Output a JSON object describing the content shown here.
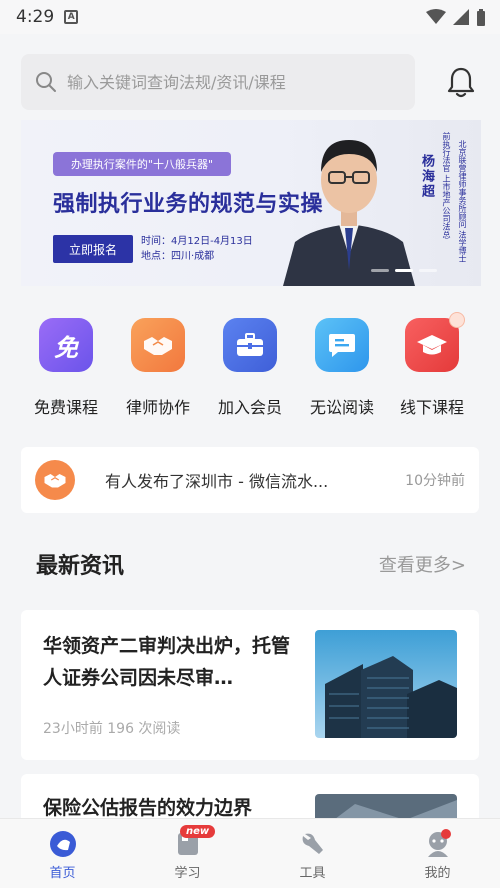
{
  "status": {
    "time": "4:29",
    "app_badge": "A"
  },
  "search": {
    "placeholder": "输入关键词查询法规/资讯/课程"
  },
  "banner": {
    "tag": "办理执行案件的\"十八般兵器\"",
    "title": "强制执行业务的规范与实操",
    "button": "立即报名",
    "time_line": "时间：4月12日-4月13日",
    "place_line": "地点：四川·成都",
    "speaker_name": "杨海超",
    "speaker_title_1": "前执行法官 上市地产公司法总",
    "speaker_title_2": "北京联营律师事务所顾问 法学博士"
  },
  "quick_links": [
    {
      "label": "免费课程",
      "icon": "free-icon",
      "color": "#7b5cf2"
    },
    {
      "label": "律师协作",
      "icon": "handshake-icon",
      "color": "#f38a48"
    },
    {
      "label": "加入会员",
      "icon": "briefcase-icon",
      "color": "#4c6fe6"
    },
    {
      "label": "无讼阅读",
      "icon": "reading-icon",
      "color": "#3ca7f0"
    },
    {
      "label": "线下课程",
      "icon": "graduation-cap-icon",
      "color": "#ef4545"
    }
  ],
  "notice": {
    "text": "有人发布了深圳市 - 微信流水...",
    "time": "10分钟前"
  },
  "news_section": {
    "title": "最新资讯",
    "more": "查看更多>"
  },
  "news": [
    {
      "title": "华领资产二审判决出炉，托管人证券公司因未尽审…",
      "meta": "23小时前 196 次阅读"
    },
    {
      "title": "保险公估报告的效力边界"
    }
  ],
  "tabs": [
    {
      "label": "首页",
      "icon": "home-icon"
    },
    {
      "label": "学习",
      "icon": "study-icon",
      "badge": "new"
    },
    {
      "label": "工具",
      "icon": "tools-icon"
    },
    {
      "label": "我的",
      "icon": "profile-icon"
    }
  ],
  "colors": {
    "accent": "#3a5bd6",
    "banner_title": "#2a2f9b",
    "badge": "#e63b3b"
  }
}
